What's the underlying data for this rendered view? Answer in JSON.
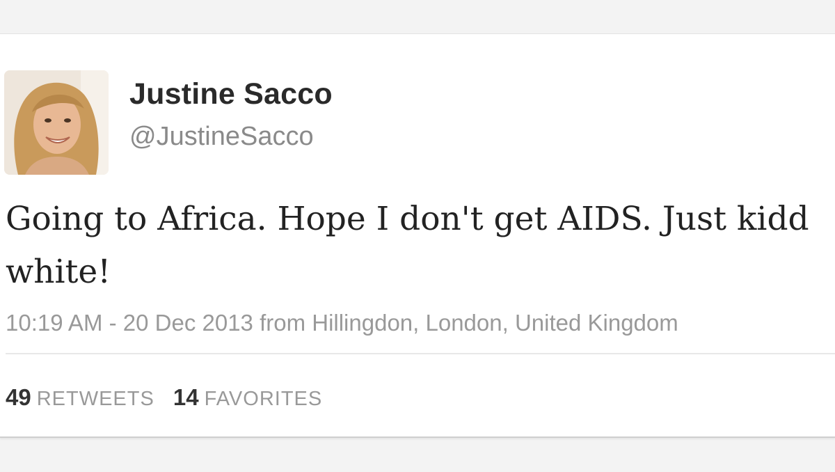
{
  "tweet": {
    "avatar_icon": "profile-photo",
    "display_name": "Justine Sacco",
    "screen_name": "@JustineSacco",
    "text_line1": "Going to Africa. Hope I don't get AIDS. Just kidd",
    "text_line2": "white!",
    "timestamp": "10:19 AM - 20 Dec 2013 from Hillingdon, London, United Kingdom"
  },
  "stats": {
    "retweets_count": "49",
    "retweets_label": "RETWEETS",
    "favorites_count": "14",
    "favorites_label": "FAVORITES"
  }
}
